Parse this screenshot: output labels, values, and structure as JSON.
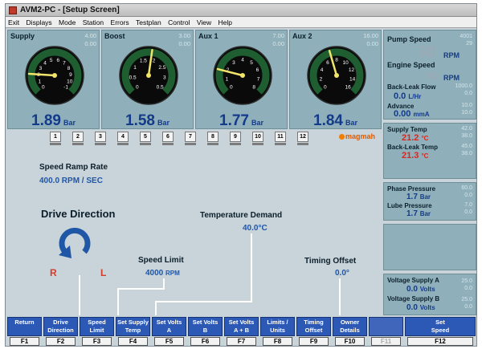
{
  "window": {
    "title": "AVM2-PC - [Setup Screen]"
  },
  "menu": [
    "Exit",
    "Displays",
    "Mode",
    "Station",
    "Errors",
    "Testplan",
    "Control",
    "View",
    "Help"
  ],
  "gauges": [
    {
      "label": "Supply",
      "max": "4.00",
      "min": "0.00",
      "value": "1.89",
      "unit": "Bar",
      "scale": [
        "0",
        "1",
        "2",
        "3",
        "4",
        "5",
        "6",
        "7",
        "8",
        "9",
        "10",
        "-1"
      ],
      "needle_frac": 0.18
    },
    {
      "label": "Boost",
      "max": "3.00",
      "min": "0.00",
      "value": "1.58",
      "unit": "Bar",
      "scale": [
        "0",
        "0.5",
        "1",
        "1.5",
        "2",
        "2.5",
        "3",
        "0.5"
      ],
      "needle_frac": 0.53
    },
    {
      "label": "Aux 1",
      "max": "7.00",
      "min": "0.00",
      "value": "1.77",
      "unit": "Bar",
      "scale": [
        "0",
        "1",
        "2",
        "3",
        "4",
        "5",
        "6",
        "7",
        "8"
      ],
      "needle_frac": 0.22
    },
    {
      "label": "Aux 2",
      "max": "16.00",
      "min": "0.00",
      "value": "1.84",
      "unit": "Bar",
      "scale": [
        "0",
        "2",
        "4",
        "6",
        "8",
        "10",
        "12",
        "14",
        "16"
      ],
      "needle_frac": 0.44
    }
  ],
  "stations": [
    "1",
    "2",
    "3",
    "4",
    "5",
    "6",
    "7",
    "8",
    "9",
    "10",
    "11",
    "12"
  ],
  "brand": "magmah",
  "main": {
    "speed_ramp": {
      "label": "Speed Ramp Rate",
      "value": "400.0 RPM / SEC"
    },
    "drive": {
      "label": "Drive Direction",
      "r": "R",
      "l": "L"
    },
    "temp_demand": {
      "label": "Temperature Demand",
      "value": "40.0°C"
    },
    "speed_limit": {
      "label": "Speed Limit",
      "value": "4000",
      "unit": "RPM"
    },
    "timing_offset": {
      "label": "Timing Offset",
      "value": "0.0°"
    }
  },
  "right": {
    "pump_speed": {
      "label": "Pump Speed",
      "value": "30",
      "unit": "RPM",
      "max": "4001",
      "min": "29"
    },
    "engine_speed": {
      "label": "Engine Speed",
      "value": "60",
      "unit": "RPM"
    },
    "backleak_flow": {
      "label": "Back-Leak Flow",
      "value": "0.0",
      "unit": "L/Hr",
      "max": "1000.0",
      "min": "0.0"
    },
    "advance": {
      "label": "Advance",
      "value": "0.00",
      "unit": "mmA",
      "max": "10.0",
      "min": "10.0"
    },
    "supply_temp": {
      "label": "Supply Temp",
      "value": "21.2",
      "unit": "°C",
      "max": "42.0",
      "min": "38.0"
    },
    "backleak_temp": {
      "label": "Back-Leak Temp",
      "value": "21.3",
      "unit": "°C",
      "max": "45.0",
      "min": "38.0"
    },
    "phase_pressure": {
      "label": "Phase Pressure",
      "value": "1.7",
      "unit": "Bar",
      "max": "60.0",
      "min": "0.0"
    },
    "lube_pressure": {
      "label": "Lube Pressure",
      "value": "1.7",
      "unit": "Bar",
      "max": "7.0",
      "min": "0.0"
    },
    "volt_a": {
      "label": "Voltage Supply A",
      "value": "0.0",
      "unit": "Volts",
      "max": "25.0",
      "min": "0.0"
    },
    "volt_b": {
      "label": "Voltage Supply B",
      "value": "0.0",
      "unit": "Volts",
      "max": "25.0",
      "min": "0.0"
    }
  },
  "fkeys": [
    {
      "label1": "Return",
      "label2": "",
      "key": "F1"
    },
    {
      "label1": "Drive",
      "label2": "Direction",
      "key": "F2"
    },
    {
      "label1": "Speed",
      "label2": "Limit",
      "key": "F3"
    },
    {
      "label1": "Set Supply",
      "label2": "Temp",
      "key": "F4"
    },
    {
      "label1": "Set Volts",
      "label2": "A",
      "key": "F5"
    },
    {
      "label1": "Set Volts",
      "label2": "B",
      "key": "F6"
    },
    {
      "label1": "Set Volts",
      "label2": "A + B",
      "key": "F7"
    },
    {
      "label1": "Limits /",
      "label2": "Units",
      "key": "F8"
    },
    {
      "label1": "Timing",
      "label2": "Offset",
      "key": "F9"
    },
    {
      "label1": "Owner",
      "label2": "Details",
      "key": "F10"
    },
    {
      "label1": "",
      "label2": "",
      "key": "F11",
      "disabled": true
    },
    {
      "label1": "Set",
      "label2": "Speed",
      "key": "F12"
    }
  ],
  "colors": {
    "panel": "#8fb0ba",
    "background": "#c9d3da",
    "value_blue": "#1f56a6",
    "alert_red": "#e0241c",
    "fkey_blue": "#2c58b6",
    "gauge_green": "#1e5e30"
  }
}
